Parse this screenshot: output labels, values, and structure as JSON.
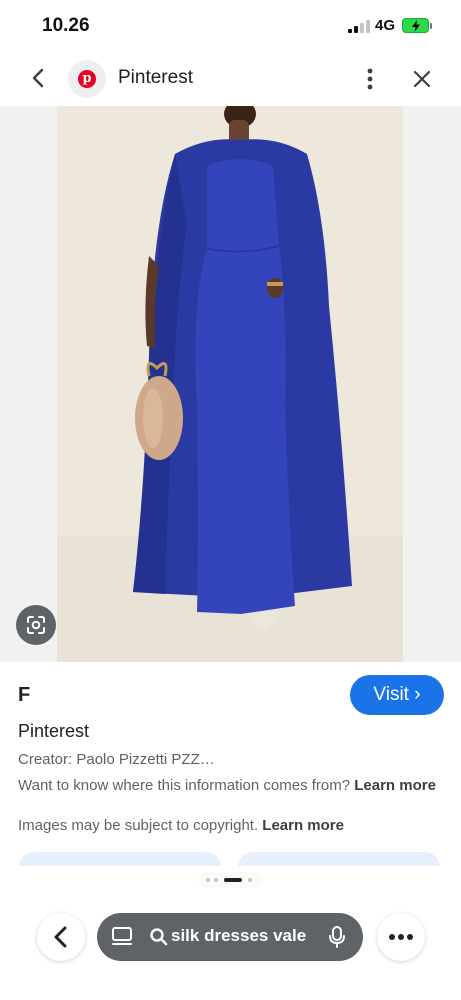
{
  "status": {
    "time": "10.26",
    "network": "4G",
    "icons": [
      "signal-icon",
      "battery-charging-icon"
    ]
  },
  "header": {
    "title": "Pinterest",
    "icons": [
      "back-arrow-icon",
      "pinterest-logo-icon",
      "more-vert-icon",
      "close-icon"
    ]
  },
  "image": {
    "lens_icon": "google-lens-icon",
    "accent_color": "#2e3ea8"
  },
  "result": {
    "letter": "F",
    "visit_label": "Visit ›",
    "source": "Pinterest",
    "creator": "Creator: Paolo Pizzetti PZZ…",
    "where_text": "Want to know where this information comes from?",
    "where_link": "Learn more",
    "copyright_text": "Images may be subject to copyright.",
    "copyright_link": "Learn more"
  },
  "bottom_bar": {
    "search_query": "silk dresses vale",
    "icons": [
      "back-chevron-icon",
      "tab-switcher-icon",
      "search-icon",
      "mic-icon",
      "more-horiz-icon"
    ]
  },
  "colors": {
    "visit_button": "#1a73e8",
    "search_pill": "#5f6368",
    "pinterest_red": "#e60023"
  }
}
